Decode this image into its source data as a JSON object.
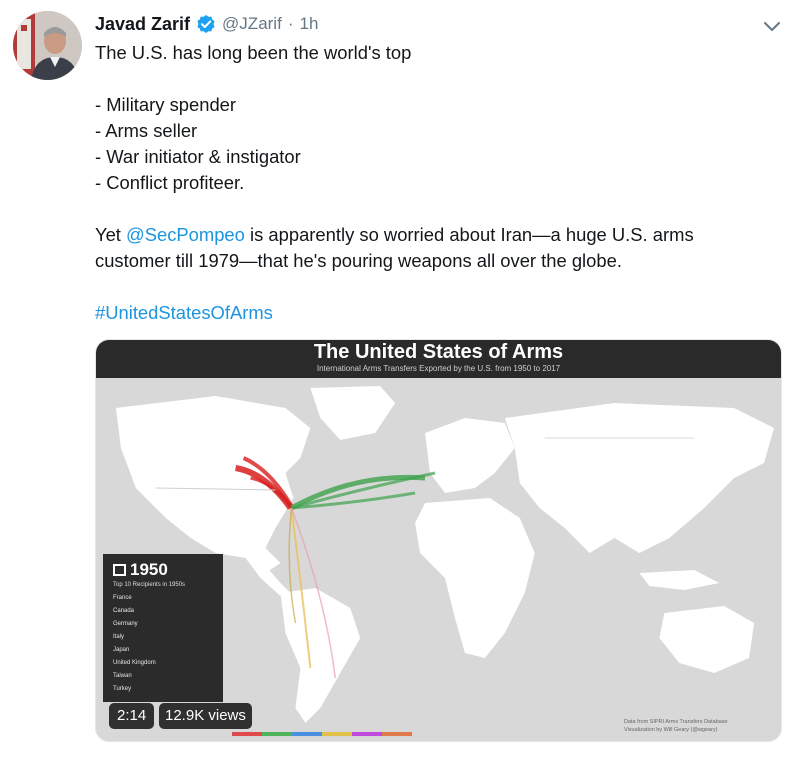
{
  "tweet": {
    "author": "Javad Zarif",
    "handle": "@JZarif",
    "separator": "·",
    "time": "1h",
    "lines": {
      "l1": "The U.S. has long been the world's top",
      "l2": "- Military spender",
      "l3": "- Arms seller",
      "l4": "- War initiator & instigator",
      "l5": "- Conflict profiteer.",
      "l6_pre": "Yet ",
      "l6_mention": "@SecPompeo",
      "l6_post": " is apparently so worried about Iran—a huge U.S. arms",
      "l7": "customer till 1979—that he's pouring weapons all over the globe.",
      "hashtag": "#UnitedStatesOfArms"
    }
  },
  "media": {
    "title": "The United States of Arms",
    "subtitle": "International Arms Transfers Exported by the U.S. from 1950 to 2017",
    "year": "1950",
    "panel_subtitle": "Top 10 Recipients in 1950s",
    "recipients": [
      "France",
      "Canada",
      "Germany",
      "Italy",
      "Japan",
      "United Kingdom",
      "Taiwan",
      "Turkey"
    ],
    "duration": "2:14",
    "views": "12.9K views",
    "credit_l1": "Data from SIPRI Arms Transfers Database",
    "credit_l2": "Visualization by Will Geary (@wgeary)"
  },
  "colors": {
    "link": "#1b95e0",
    "verified": "#1da1f2",
    "muted": "#657786",
    "flow_red": "#d81e1e",
    "flow_green": "#3fa34d"
  },
  "icons": {
    "verified": "verified-badge-icon",
    "chevron": "chevron-down-icon",
    "calendar": "calendar-icon"
  }
}
